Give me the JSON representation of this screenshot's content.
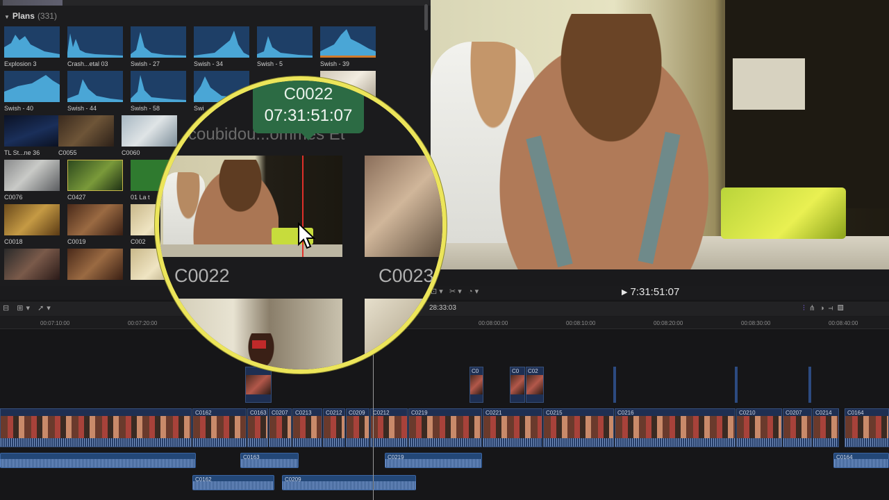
{
  "browser": {
    "section_title": "Plans",
    "section_count": "(331)",
    "clips": [
      {
        "label": "Explosion 3",
        "kind": "audio"
      },
      {
        "label": "Crash...etal 03",
        "kind": "audio"
      },
      {
        "label": "Swish - 27",
        "kind": "audio"
      },
      {
        "label": "Swish - 34",
        "kind": "audio"
      },
      {
        "label": "Swish - 5",
        "kind": "audio"
      },
      {
        "label": "Swish - 39",
        "kind": "audio"
      },
      {
        "label": "Swish - 40",
        "kind": "audio"
      },
      {
        "label": "Swish - 44",
        "kind": "audio"
      },
      {
        "label": "Swish - 58",
        "kind": "audio"
      },
      {
        "label": "Swi",
        "kind": "audio"
      },
      {
        "label": "TL St...ne 36",
        "kind": "video"
      },
      {
        "label": "C0055",
        "kind": "video"
      },
      {
        "label": "C0060",
        "kind": "video"
      },
      {
        "label": "C0076",
        "kind": "video"
      },
      {
        "label": "C0427",
        "kind": "video"
      },
      {
        "label": "01 La t",
        "kind": "video"
      },
      {
        "label": "C0018",
        "kind": "video"
      },
      {
        "label": "C0019",
        "kind": "video"
      },
      {
        "label": "C002",
        "kind": "video"
      }
    ]
  },
  "viewer": {
    "timecode": "7:31:51:07"
  },
  "timeline": {
    "timecode_display": "28:33:03",
    "ruler_labels": [
      "00:07:10:00",
      "00:07:20:00",
      "00:08:00:00",
      "00:08:10:00",
      "00:08:20:00",
      "00:08:30:00",
      "00:08:40:00"
    ],
    "primary_clips": [
      "C0162",
      "C0163",
      "C0207",
      "C0213",
      "C0212",
      "C0209",
      "C0212",
      "C0219",
      "C0221",
      "C0215",
      "C0216",
      "C0210",
      "C0207",
      "C0214",
      "C0164"
    ],
    "connected_clips": [
      "C0",
      "C0",
      "C02"
    ],
    "audio_clips": [
      "C0163",
      "C0219",
      "C0164",
      "C0162",
      "C0209"
    ]
  },
  "magnifier": {
    "skim_clip_name": "C0022",
    "skim_timecode": "07:31:51:07",
    "ghost_title": "scoubidou...ommes Et",
    "thumb_label_left": "C0022",
    "thumb_label_right": "C0023"
  },
  "colors": {
    "magnifier_ring": "#ece55a",
    "skimmer_box": "#2c6b44",
    "playhead_red": "#e0302a",
    "clip_blue": "#1e2f52"
  }
}
